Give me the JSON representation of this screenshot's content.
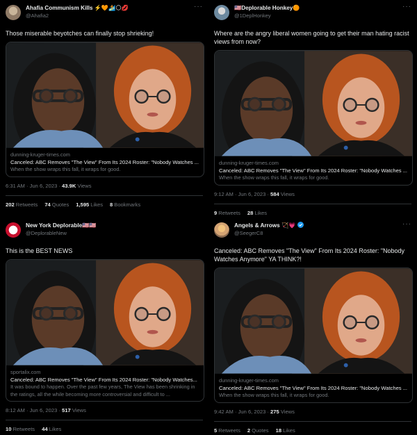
{
  "tweets": [
    {
      "display_name": "Ahafia Communism Kills ⚡️🧡🏄🌕💋",
      "handle": "@Ahafia2",
      "text": "Those miserable beyotches can finally stop shrieking!",
      "card": {
        "domain": "dunning-kruger-times.com",
        "title": "Canceled: ABC Removes \"The View\" From Its 2024 Roster: \"Nobody Watches ...",
        "description": "When the show wraps this fall, it wraps for good."
      },
      "time": "6:31 AM · Jun 6, 2023 · ",
      "views_count": "43.9K",
      "views_label": " Views",
      "stats": [
        {
          "count": "202",
          "label": "Retweets"
        },
        {
          "count": "74",
          "label": "Quotes"
        },
        {
          "count": "1,595",
          "label": "Likes"
        },
        {
          "count": "8",
          "label": "Bookmarks"
        }
      ]
    },
    {
      "display_name": "🇺🇸Deplorable Honkey🟠",
      "handle": "@1DeplHonkey",
      "text": "Where are the angry liberal women going to get their man hating racist views from now?",
      "card": {
        "domain": "dunning-kruger-times.com",
        "title": "Canceled: ABC Removes \"The View\" From Its 2024 Roster: \"Nobody Watches ...",
        "description": "When the show wraps this fall, it wraps for good."
      },
      "time": "9:12 AM · Jun 6, 2023 · ",
      "views_count": "584",
      "views_label": " Views",
      "stats": [
        {
          "count": "9",
          "label": "Retweets"
        },
        {
          "count": "28",
          "label": "Likes"
        }
      ]
    },
    {
      "display_name": "New York Deplorable🇺🇸🇺🇸",
      "handle": "@DeplorableNew",
      "text": "This is the BEST NEWS",
      "card": {
        "domain": "sportalix.com",
        "title": "Canceled: ABC Removes \"The View\" From Its 2024 Roster: \"Nobody Watches...",
        "description": "It was bound to happen. Over the past few years, The View has been shrinking in the ratings, all the while becoming more controversial and difficult to ..."
      },
      "time": "8:12 AM · Jun 6, 2023 · ",
      "views_count": "517",
      "views_label": " Views",
      "stats": [
        {
          "count": "10",
          "label": "Retweets"
        },
        {
          "count": "44",
          "label": "Likes"
        }
      ]
    },
    {
      "display_name": "Angels & Arrows 🏹💗",
      "handle": "@SeegerC8",
      "text": "Canceled: ABC Removes \"The View\" From Its 2024 Roster: \"Nobody Watches Anymore\" YA THINK?!",
      "card": {
        "domain": "dunning-kruger-times.com",
        "title": "Canceled: ABC Removes \"The View\" From Its 2024 Roster: \"Nobody Watches ...",
        "description": "When the show wraps this fall, it wraps for good."
      },
      "time": "9:42 AM · Jun 6, 2023 · ",
      "views_count": "275",
      "views_label": " Views",
      "stats": [
        {
          "count": "5",
          "label": "Retweets"
        },
        {
          "count": "2",
          "label": "Quotes"
        },
        {
          "count": "18",
          "label": "Likes"
        }
      ]
    }
  ],
  "more_glyph": "···",
  "verified_color": "#1d9bf0"
}
